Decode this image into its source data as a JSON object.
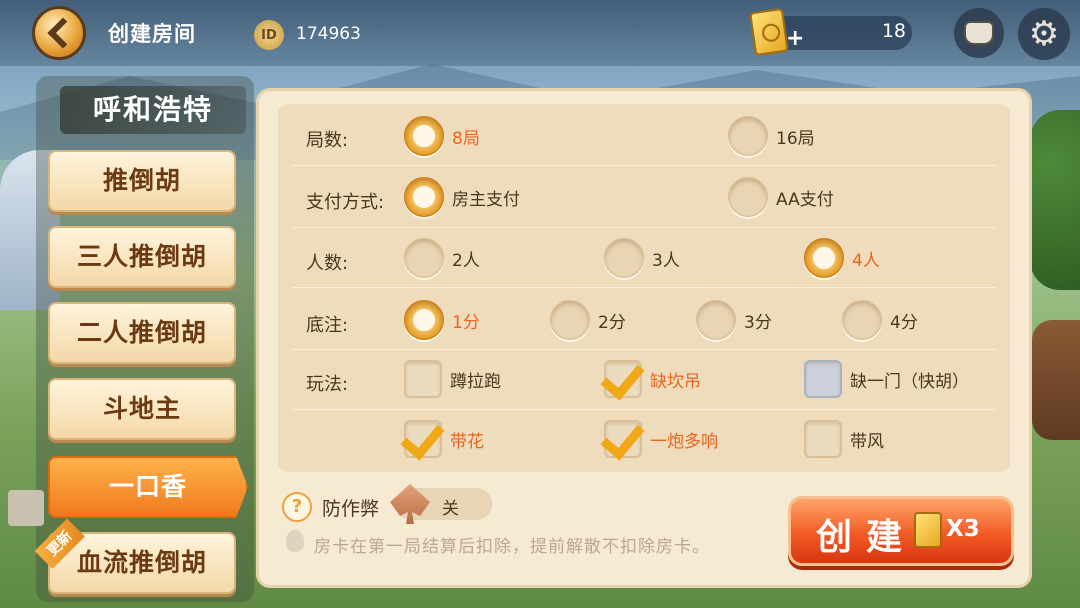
{
  "header": {
    "title": "创建房间",
    "id_label": "ID",
    "id_value": "174963",
    "room_cards": "18",
    "plus": "+"
  },
  "sidebar": {
    "region": "呼和浩特",
    "items": [
      {
        "label": "推倒胡",
        "active": false
      },
      {
        "label": "三人推倒胡",
        "active": false
      },
      {
        "label": "二人推倒胡",
        "active": false
      },
      {
        "label": "斗地主",
        "active": false
      },
      {
        "label": "一口香",
        "active": true
      },
      {
        "label": "血流推倒胡",
        "active": false,
        "badge": "更新"
      }
    ]
  },
  "options": {
    "rounds": {
      "label": "局数:",
      "choices": [
        "8局",
        "16局"
      ],
      "selected": "8局"
    },
    "payment": {
      "label": "支付方式:",
      "choices": [
        "房主支付",
        "AA支付"
      ],
      "selected": "房主支付"
    },
    "players": {
      "label": "人数:",
      "choices": [
        "2人",
        "3人",
        "4人"
      ],
      "selected": "4人"
    },
    "base": {
      "label": "底注:",
      "choices": [
        "1分",
        "2分",
        "3分",
        "4分"
      ],
      "selected": "1分"
    },
    "rules": {
      "label": "玩法:",
      "items": [
        {
          "label": "蹲拉跑",
          "checked": false,
          "disabled": false
        },
        {
          "label": "缺坎吊",
          "checked": true,
          "disabled": false
        },
        {
          "label": "缺一门（快胡）",
          "checked": false,
          "disabled": true
        },
        {
          "label": "带花",
          "checked": true,
          "disabled": false
        },
        {
          "label": "一炮多响",
          "checked": true,
          "disabled": false
        },
        {
          "label": "带风",
          "checked": false,
          "disabled": false
        }
      ]
    }
  },
  "footer": {
    "help": "?",
    "anticheat_label": "防作弊",
    "anticheat_state": "关",
    "notice": "房卡在第一局结算后扣除，提前解散不扣除房卡。",
    "create_label": "创建",
    "create_cost": "X3"
  },
  "colors": {
    "accent": "#f07a1e",
    "selected_text": "#e8661e",
    "panel": "#f6ead2",
    "text": "#4e3520"
  }
}
